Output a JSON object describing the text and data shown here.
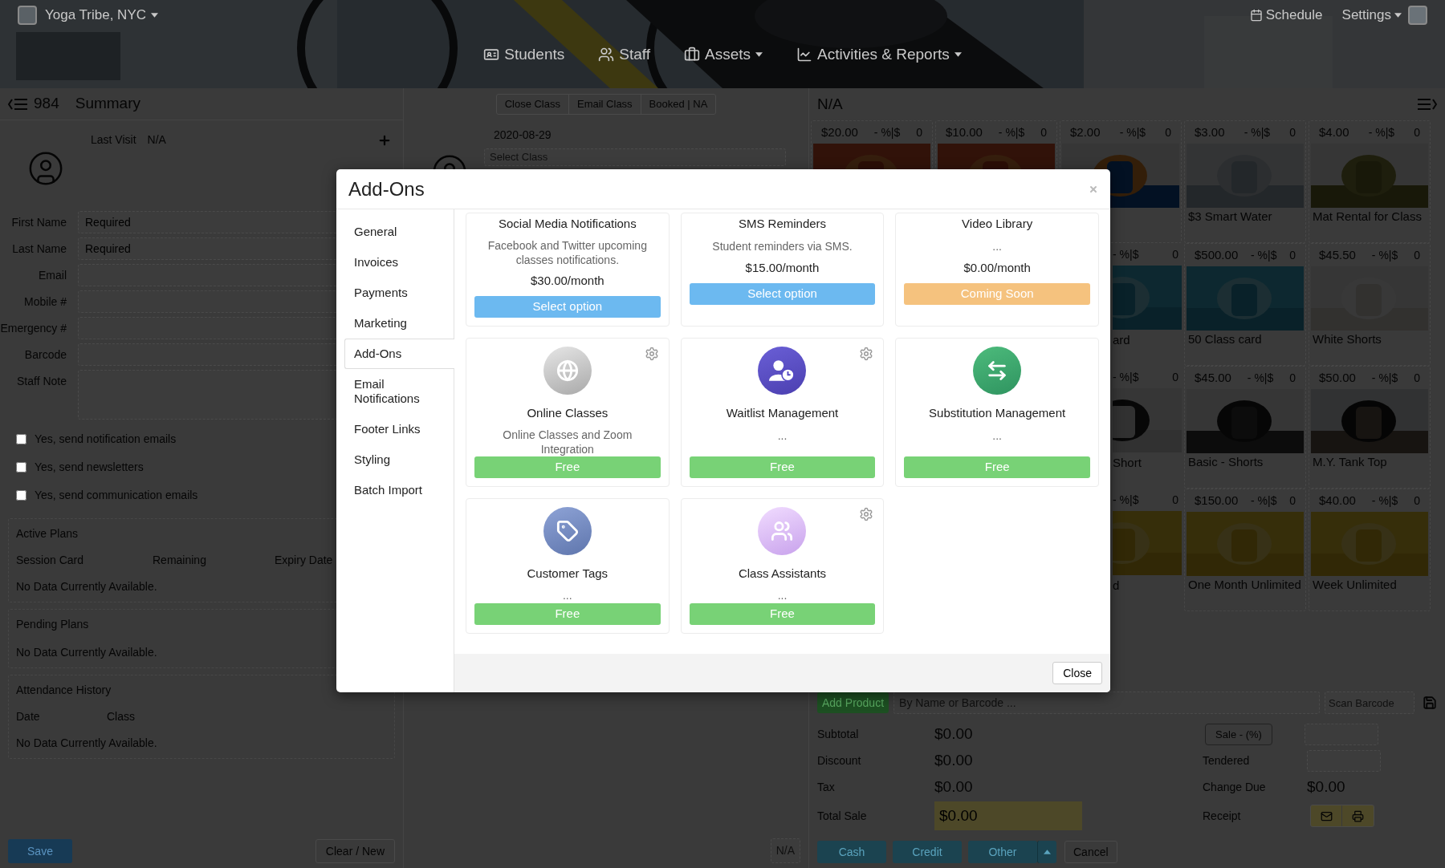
{
  "header": {
    "brand": "Yoga Tribe, NYC",
    "nav": [
      {
        "label": "Students",
        "dropdown": false
      },
      {
        "label": "Staff",
        "dropdown": false
      },
      {
        "label": "Assets",
        "dropdown": true
      },
      {
        "label": "Activities & Reports",
        "dropdown": true
      }
    ],
    "right_links": [
      {
        "label": "Schedule",
        "dropdown": false
      },
      {
        "label": "Settings",
        "dropdown": true
      }
    ]
  },
  "member_panel": {
    "member_id": "984",
    "title": "Summary",
    "last_visit_label": "Last Visit",
    "last_visit": "N/A",
    "fields": [
      {
        "label": "First Name",
        "placeholder": "Required",
        "kind": "text"
      },
      {
        "label": "Last Name",
        "placeholder": "Required",
        "kind": "text"
      },
      {
        "label": "Email",
        "kind": "text"
      },
      {
        "label": "Mobile #",
        "kind": "text"
      },
      {
        "label": "Emergency #",
        "kind": "text"
      },
      {
        "label": "Barcode",
        "kind": "text"
      },
      {
        "label": "Staff Note",
        "kind": "textarea"
      }
    ],
    "checkboxes": [
      {
        "label": "Yes, send notification emails",
        "checked": false
      },
      {
        "label": "Yes, send newsletters",
        "checked": false
      },
      {
        "label": "Yes, send communication emails",
        "checked": false
      }
    ],
    "active_plans": {
      "title": "Active Plans",
      "columns": [
        "Session Card",
        "Remaining",
        "Expiry Date"
      ],
      "empty": "No Data Currently Available."
    },
    "pending_plans": {
      "title": "Pending Plans",
      "empty": "No Data Currently Available."
    },
    "attendance_history": {
      "title": "Attendance History",
      "columns": [
        "Date",
        "Class"
      ],
      "empty": "No Data Currently Available."
    },
    "save_button": "Save",
    "clear_button": "Clear / New"
  },
  "class_panel": {
    "actions": [
      "Close Class",
      "Email Class",
      "Booked | NA"
    ],
    "date": "2020-08-29",
    "class_select": {
      "placeholder": "Select Class"
    },
    "footer": "N/A"
  },
  "pos_panel": {
    "title": "N/A",
    "product_rows": [
      [
        {
          "kind": "full",
          "price": "$20.00",
          "discount": "- %|$",
          "count": "0"
        },
        {
          "kind": "full",
          "price": "$10.00",
          "discount": "- %|$",
          "count": "0"
        },
        {
          "kind": "full",
          "price": "$2.00",
          "discount": "- %|$",
          "count": "0"
        },
        {
          "kind": "full",
          "price": "$3.00",
          "discount": "- %|$",
          "count": "0",
          "name": "$3 Smart Water"
        },
        {
          "kind": "full",
          "price": "$4.00",
          "discount": "- %|$",
          "count": "0",
          "name": "Mat Rental for Class"
        }
      ],
      [
        {
          "kind": "cut",
          "discount": "- %|$",
          "count": "0",
          "name": "ard"
        },
        {
          "kind": "full",
          "price": "$500.00",
          "discount": "- %|$",
          "count": "0",
          "name": "50 Class card"
        },
        {
          "kind": "full",
          "price": "$45.50",
          "discount": "- %|$",
          "count": "0",
          "name": "White Shorts"
        }
      ],
      [
        {
          "kind": "cut",
          "discount": "- %|$",
          "count": "0",
          "name": "Short"
        },
        {
          "kind": "full",
          "price": "$45.00",
          "discount": "- %|$",
          "count": "0",
          "name": "Basic - Shorts"
        },
        {
          "kind": "full",
          "price": "$50.00",
          "discount": "- %|$",
          "count": "0",
          "name": "M.Y. Tank Top"
        }
      ],
      [
        {
          "kind": "cut",
          "discount": "- %|$",
          "count": "0",
          "name": "d"
        },
        {
          "kind": "full",
          "price": "$150.00",
          "discount": "- %|$",
          "count": "0",
          "name": "One Month Unlimited"
        },
        {
          "kind": "full",
          "price": "$40.00",
          "discount": "- %|$",
          "count": "0",
          "name": "Week Unlimited"
        }
      ]
    ],
    "add_product_button": "Add Product",
    "search": {
      "placeholder": "By Name or Barcode ..."
    },
    "scan": {
      "placeholder": "Scan Barcode"
    },
    "totals": [
      {
        "label": "Subtotal",
        "value": "$0.00",
        "kind": "plain"
      },
      {
        "label": "Discount",
        "value": "$0.00",
        "kind": "plain"
      },
      {
        "label": "Tax",
        "value": "$0.00",
        "kind": "plain"
      },
      {
        "label": "Total Sale",
        "value": "$0.00",
        "kind": "total"
      }
    ],
    "sale_button": "Sale - (%)",
    "tendered_label": "Tendered",
    "change_due_label": "Change Due",
    "change_due": "$0.00",
    "receipt_label": "Receipt",
    "payment_buttons": [
      "Cash",
      "Credit",
      "Other"
    ],
    "cancel_button": "Cancel"
  },
  "modal": {
    "title": "Add-Ons",
    "sidebar": [
      {
        "label": "General",
        "selected": false
      },
      {
        "label": "Invoices",
        "selected": false
      },
      {
        "label": "Payments",
        "selected": false
      },
      {
        "label": "Marketing",
        "selected": false
      },
      {
        "label": "Add-Ons",
        "selected": true
      },
      {
        "label": "Email Notifications",
        "selected": false
      },
      {
        "label": "Footer Links",
        "selected": false
      },
      {
        "label": "Styling",
        "selected": false
      },
      {
        "label": "Batch Import",
        "selected": false
      }
    ],
    "cards": [
      {
        "title": "Social Media Notifications",
        "description": "Facebook and Twitter upcoming classes notifications.",
        "price": "$30.00/month",
        "button": {
          "label": "Select option",
          "kind": "select"
        }
      },
      {
        "title": "SMS Reminders",
        "description": "Student reminders via SMS.",
        "price": "$15.00/month",
        "button": {
          "label": "Select option",
          "kind": "select"
        }
      },
      {
        "title": "Video Library",
        "description": "...",
        "price": "$0.00/month",
        "button": {
          "label": "Coming Soon",
          "kind": "soon"
        }
      },
      {
        "settings": true,
        "title": "Online Classes",
        "description": "Online Classes and Zoom Integration",
        "button": {
          "label": "Free",
          "kind": "free"
        }
      },
      {
        "settings": true,
        "title": "Waitlist Management",
        "description": "...",
        "button": {
          "label": "Free",
          "kind": "free"
        }
      },
      {
        "settings": false,
        "title": "Substitution Management",
        "description": "...",
        "button": {
          "label": "Free",
          "kind": "free"
        }
      },
      {
        "settings": false,
        "title": "Customer Tags",
        "description": "...",
        "button": {
          "label": "Free",
          "kind": "free"
        }
      },
      {
        "settings": true,
        "title": "Class Assistants",
        "description": "...",
        "button": {
          "label": "Free",
          "kind": "free"
        }
      }
    ],
    "close_button": "Close"
  }
}
